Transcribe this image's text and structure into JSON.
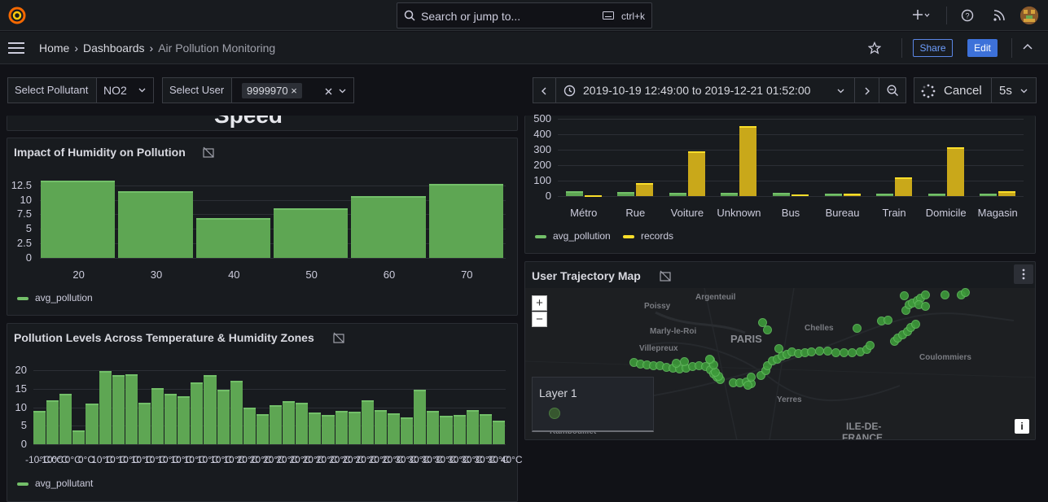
{
  "search": {
    "placeholder": "Search or jump to...",
    "shortcut": "ctrl+k"
  },
  "breadcrumbs": {
    "home": "Home",
    "dashboards": "Dashboards",
    "current": "Air Pollution Monitoring"
  },
  "actions": {
    "share": "Share",
    "edit": "Edit"
  },
  "variables": {
    "pollutant_label": "Select Pollutant",
    "pollutant_value": "NO2",
    "user_label": "Select User",
    "user_value": "9999970"
  },
  "timepicker": {
    "range": "2019-10-19 12:49:00 to 2019-12-21 01:52:00",
    "cancel": "Cancel",
    "refresh": "5s"
  },
  "cut_panel_text": "Speed",
  "panels": {
    "humidity": {
      "title": "Impact of Humidity on Pollution",
      "legend": "avg_pollution"
    },
    "temp_humidity": {
      "title": "Pollution Levels Across Temperature & Humidity Zones",
      "legend": "avg_pollutant"
    },
    "location": {
      "legend_a": "avg_pollution",
      "legend_b": "records"
    },
    "map": {
      "title": "User Trajectory Map",
      "layer": "Layer 1",
      "zoom_in": "+",
      "zoom_out": "−",
      "info": "i"
    }
  },
  "map_labels": [
    "Poissy",
    "Argenteuil",
    "Marly-le-Roi",
    "PARIS",
    "Chelles",
    "Villepreux",
    "Coulommiers",
    "Yerres",
    "ILE-DE-",
    "FRANCE",
    "Rambouillet"
  ],
  "colors": {
    "green": "#73bf69",
    "yellow": "#fade2a",
    "accent": "#3d71d9"
  },
  "chart_data": [
    {
      "type": "bar",
      "title": "Impact of Humidity on Pollution",
      "categories": [
        "20",
        "30",
        "40",
        "50",
        "60",
        "70"
      ],
      "series": [
        {
          "name": "avg_pollution",
          "values": [
            13.3,
            11.5,
            6.9,
            8.5,
            10.7,
            12.7
          ]
        }
      ],
      "yticks": [
        "12.5",
        "10",
        "7.5",
        "5",
        "2.5",
        "0"
      ],
      "ylim": [
        0,
        13.3
      ]
    },
    {
      "type": "bar",
      "title": "Pollution Levels Across Temperature & Humidity Zones",
      "categories": [
        "-10°C",
        "-10°C",
        "0°C",
        "0°C",
        "0°C",
        "10°C",
        "10°C",
        "10°C",
        "10°C",
        "10°C",
        "10°C",
        "10°C",
        "10°C",
        "10°C",
        "10°C",
        "10°C",
        "20°C",
        "20°C",
        "20°C",
        "20°C",
        "20°C",
        "20°C",
        "20°C",
        "20°C",
        "20°C",
        "20°C",
        "20°C",
        "20°C",
        "30°C",
        "30°C",
        "30°C",
        "30°C",
        "30°C",
        "30°C",
        "30°C",
        "30°C",
        "40°C"
      ],
      "series": [
        {
          "name": "avg_pollutant",
          "values": [
            9,
            11.8,
            13.7,
            3.8,
            10.9,
            19.8,
            18.6,
            18.8,
            11.3,
            15.2,
            13.6,
            13,
            16.6,
            18.6,
            14.7,
            17.1,
            9.9,
            8.2,
            10.5,
            11.6,
            11.3,
            8.5,
            7.9,
            9,
            8.8,
            11.8,
            9.2,
            8.4,
            7.2,
            14.8,
            9,
            7.8,
            8,
            9.2,
            8.2,
            6.4
          ]
        }
      ],
      "yticks": [
        "20",
        "15",
        "10",
        "5",
        "0"
      ],
      "ylim": [
        0,
        20
      ]
    },
    {
      "type": "bar",
      "categories": [
        "Métro",
        "Rue",
        "Voiture",
        "Unknown",
        "Bus",
        "Bureau",
        "Train",
        "Domicile",
        "Magasin"
      ],
      "series": [
        {
          "name": "avg_pollution",
          "values": [
            32,
            28,
            20,
            22,
            22,
            18,
            14,
            16,
            14
          ]
        },
        {
          "name": "records",
          "values": [
            5,
            85,
            290,
            455,
            12,
            18,
            120,
            315,
            30
          ]
        }
      ],
      "yticks": [
        "500",
        "400",
        "300",
        "200",
        "100",
        "0"
      ],
      "ylim": [
        0,
        500
      ]
    }
  ]
}
